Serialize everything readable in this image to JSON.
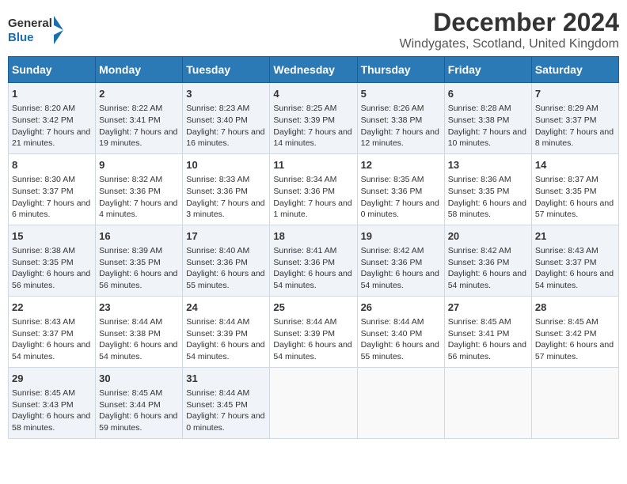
{
  "logo": {
    "line1": "General",
    "line2": "Blue"
  },
  "title": "December 2024",
  "subtitle": "Windygates, Scotland, United Kingdom",
  "header_days": [
    "Sunday",
    "Monday",
    "Tuesday",
    "Wednesday",
    "Thursday",
    "Friday",
    "Saturday"
  ],
  "weeks": [
    [
      {
        "day": "1",
        "rise": "Sunrise: 8:20 AM",
        "set": "Sunset: 3:42 PM",
        "daylight": "Daylight: 7 hours and 21 minutes."
      },
      {
        "day": "2",
        "rise": "Sunrise: 8:22 AM",
        "set": "Sunset: 3:41 PM",
        "daylight": "Daylight: 7 hours and 19 minutes."
      },
      {
        "day": "3",
        "rise": "Sunrise: 8:23 AM",
        "set": "Sunset: 3:40 PM",
        "daylight": "Daylight: 7 hours and 16 minutes."
      },
      {
        "day": "4",
        "rise": "Sunrise: 8:25 AM",
        "set": "Sunset: 3:39 PM",
        "daylight": "Daylight: 7 hours and 14 minutes."
      },
      {
        "day": "5",
        "rise": "Sunrise: 8:26 AM",
        "set": "Sunset: 3:38 PM",
        "daylight": "Daylight: 7 hours and 12 minutes."
      },
      {
        "day": "6",
        "rise": "Sunrise: 8:28 AM",
        "set": "Sunset: 3:38 PM",
        "daylight": "Daylight: 7 hours and 10 minutes."
      },
      {
        "day": "7",
        "rise": "Sunrise: 8:29 AM",
        "set": "Sunset: 3:37 PM",
        "daylight": "Daylight: 7 hours and 8 minutes."
      }
    ],
    [
      {
        "day": "8",
        "rise": "Sunrise: 8:30 AM",
        "set": "Sunset: 3:37 PM",
        "daylight": "Daylight: 7 hours and 6 minutes."
      },
      {
        "day": "9",
        "rise": "Sunrise: 8:32 AM",
        "set": "Sunset: 3:36 PM",
        "daylight": "Daylight: 7 hours and 4 minutes."
      },
      {
        "day": "10",
        "rise": "Sunrise: 8:33 AM",
        "set": "Sunset: 3:36 PM",
        "daylight": "Daylight: 7 hours and 3 minutes."
      },
      {
        "day": "11",
        "rise": "Sunrise: 8:34 AM",
        "set": "Sunset: 3:36 PM",
        "daylight": "Daylight: 7 hours and 1 minute."
      },
      {
        "day": "12",
        "rise": "Sunrise: 8:35 AM",
        "set": "Sunset: 3:36 PM",
        "daylight": "Daylight: 7 hours and 0 minutes."
      },
      {
        "day": "13",
        "rise": "Sunrise: 8:36 AM",
        "set": "Sunset: 3:35 PM",
        "daylight": "Daylight: 6 hours and 58 minutes."
      },
      {
        "day": "14",
        "rise": "Sunrise: 8:37 AM",
        "set": "Sunset: 3:35 PM",
        "daylight": "Daylight: 6 hours and 57 minutes."
      }
    ],
    [
      {
        "day": "15",
        "rise": "Sunrise: 8:38 AM",
        "set": "Sunset: 3:35 PM",
        "daylight": "Daylight: 6 hours and 56 minutes."
      },
      {
        "day": "16",
        "rise": "Sunrise: 8:39 AM",
        "set": "Sunset: 3:35 PM",
        "daylight": "Daylight: 6 hours and 56 minutes."
      },
      {
        "day": "17",
        "rise": "Sunrise: 8:40 AM",
        "set": "Sunset: 3:36 PM",
        "daylight": "Daylight: 6 hours and 55 minutes."
      },
      {
        "day": "18",
        "rise": "Sunrise: 8:41 AM",
        "set": "Sunset: 3:36 PM",
        "daylight": "Daylight: 6 hours and 54 minutes."
      },
      {
        "day": "19",
        "rise": "Sunrise: 8:42 AM",
        "set": "Sunset: 3:36 PM",
        "daylight": "Daylight: 6 hours and 54 minutes."
      },
      {
        "day": "20",
        "rise": "Sunrise: 8:42 AM",
        "set": "Sunset: 3:36 PM",
        "daylight": "Daylight: 6 hours and 54 minutes."
      },
      {
        "day": "21",
        "rise": "Sunrise: 8:43 AM",
        "set": "Sunset: 3:37 PM",
        "daylight": "Daylight: 6 hours and 54 minutes."
      }
    ],
    [
      {
        "day": "22",
        "rise": "Sunrise: 8:43 AM",
        "set": "Sunset: 3:37 PM",
        "daylight": "Daylight: 6 hours and 54 minutes."
      },
      {
        "day": "23",
        "rise": "Sunrise: 8:44 AM",
        "set": "Sunset: 3:38 PM",
        "daylight": "Daylight: 6 hours and 54 minutes."
      },
      {
        "day": "24",
        "rise": "Sunrise: 8:44 AM",
        "set": "Sunset: 3:39 PM",
        "daylight": "Daylight: 6 hours and 54 minutes."
      },
      {
        "day": "25",
        "rise": "Sunrise: 8:44 AM",
        "set": "Sunset: 3:39 PM",
        "daylight": "Daylight: 6 hours and 54 minutes."
      },
      {
        "day": "26",
        "rise": "Sunrise: 8:44 AM",
        "set": "Sunset: 3:40 PM",
        "daylight": "Daylight: 6 hours and 55 minutes."
      },
      {
        "day": "27",
        "rise": "Sunrise: 8:45 AM",
        "set": "Sunset: 3:41 PM",
        "daylight": "Daylight: 6 hours and 56 minutes."
      },
      {
        "day": "28",
        "rise": "Sunrise: 8:45 AM",
        "set": "Sunset: 3:42 PM",
        "daylight": "Daylight: 6 hours and 57 minutes."
      }
    ],
    [
      {
        "day": "29",
        "rise": "Sunrise: 8:45 AM",
        "set": "Sunset: 3:43 PM",
        "daylight": "Daylight: 6 hours and 58 minutes."
      },
      {
        "day": "30",
        "rise": "Sunrise: 8:45 AM",
        "set": "Sunset: 3:44 PM",
        "daylight": "Daylight: 6 hours and 59 minutes."
      },
      {
        "day": "31",
        "rise": "Sunrise: 8:44 AM",
        "set": "Sunset: 3:45 PM",
        "daylight": "Daylight: 7 hours and 0 minutes."
      },
      null,
      null,
      null,
      null
    ]
  ]
}
